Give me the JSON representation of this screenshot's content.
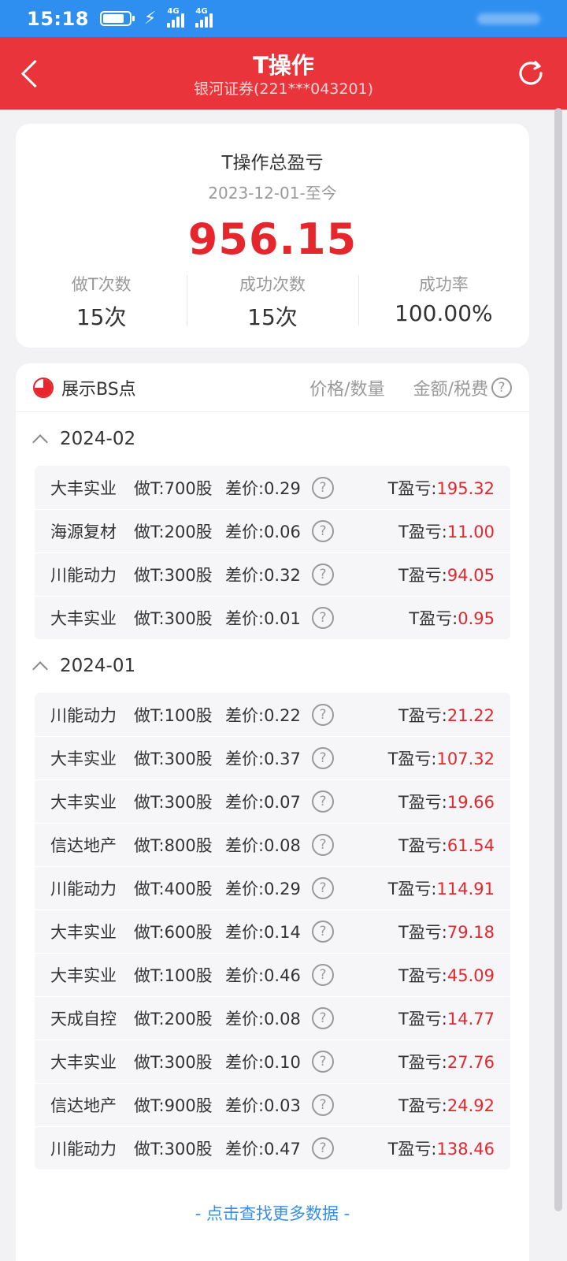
{
  "status": {
    "time": "15:18",
    "net1": "4G",
    "net2": "4G",
    "battery_level": 0.8
  },
  "header": {
    "title": "T操作",
    "subtitle": "银河证券(221***043201)"
  },
  "summary": {
    "title": "T操作总盈亏",
    "date": "2023-12-01-至今",
    "total": "956.15",
    "stats": [
      {
        "label": "做T次数",
        "value": "15次"
      },
      {
        "label": "成功次数",
        "value": "15次"
      },
      {
        "label": "成功率",
        "value": "100.00%"
      }
    ]
  },
  "list": {
    "bs_label": "展示BS点",
    "price_qty": "价格/数量",
    "amount_tax": "金额/税费",
    "help": "?",
    "pl_label": "T盈亏:",
    "groups": [
      {
        "month": "2024-02",
        "rows": [
          {
            "name": "大丰实业",
            "shares": "做T:700股",
            "diff": "差价:0.29",
            "pl": "195.32"
          },
          {
            "name": "海源复材",
            "shares": "做T:200股",
            "diff": "差价:0.06",
            "pl": "11.00"
          },
          {
            "name": "川能动力",
            "shares": "做T:300股",
            "diff": "差价:0.32",
            "pl": "94.05"
          },
          {
            "name": "大丰实业",
            "shares": "做T:300股",
            "diff": "差价:0.01",
            "pl": "0.95"
          }
        ]
      },
      {
        "month": "2024-01",
        "rows": [
          {
            "name": "川能动力",
            "shares": "做T:100股",
            "diff": "差价:0.22",
            "pl": "21.22"
          },
          {
            "name": "大丰实业",
            "shares": "做T:300股",
            "diff": "差价:0.37",
            "pl": "107.32"
          },
          {
            "name": "大丰实业",
            "shares": "做T:300股",
            "diff": "差价:0.07",
            "pl": "19.66"
          },
          {
            "name": "信达地产",
            "shares": "做T:800股",
            "diff": "差价:0.08",
            "pl": "61.54"
          },
          {
            "name": "川能动力",
            "shares": "做T:400股",
            "diff": "差价:0.29",
            "pl": "114.91"
          },
          {
            "name": "大丰实业",
            "shares": "做T:600股",
            "diff": "差价:0.14",
            "pl": "79.18"
          },
          {
            "name": "大丰实业",
            "shares": "做T:100股",
            "diff": "差价:0.46",
            "pl": "45.09"
          },
          {
            "name": "天成自控",
            "shares": "做T:200股",
            "diff": "差价:0.08",
            "pl": "14.77"
          },
          {
            "name": "大丰实业",
            "shares": "做T:300股",
            "diff": "差价:0.10",
            "pl": "27.76"
          },
          {
            "name": "信达地产",
            "shares": "做T:900股",
            "diff": "差价:0.03",
            "pl": "24.92"
          },
          {
            "name": "川能动力",
            "shares": "做T:300股",
            "diff": "差价:0.47",
            "pl": "138.46"
          }
        ]
      }
    ],
    "more": "- 点击查找更多数据 -"
  },
  "colors": {
    "header_red": "#e8343a",
    "profit_red": "#e5272d",
    "link_blue": "#3a8ee6",
    "status_blue": "#2f8ff0"
  }
}
